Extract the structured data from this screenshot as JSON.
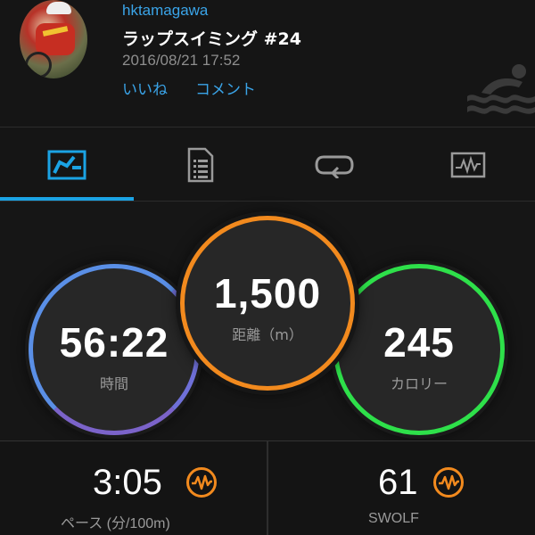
{
  "header": {
    "username": "hktamagawa",
    "activity_title": "ラップスイミング #24",
    "date": "2016/08/21 17:52",
    "like_label": "いいね",
    "comment_label": "コメント"
  },
  "tabs": [
    {
      "name": "overview",
      "icon": "activity-overview-icon",
      "active": true
    },
    {
      "name": "details",
      "icon": "document-list-icon",
      "active": false
    },
    {
      "name": "laps",
      "icon": "laps-icon",
      "active": false
    },
    {
      "name": "charts",
      "icon": "chart-icon",
      "active": false
    }
  ],
  "metrics": {
    "time": {
      "value": "56:22",
      "label": "時間",
      "color": "#5a8fe6"
    },
    "distance": {
      "value": "1,500",
      "label": "距離（m）",
      "color": "#f28a1e"
    },
    "calories": {
      "value": "245",
      "label": "カロリー",
      "color": "#2ee04a"
    }
  },
  "stats": {
    "pace": {
      "value": "3:05",
      "label": "ペース (分/100m)",
      "icon": "chart-orange-icon"
    },
    "swolf": {
      "value": "61",
      "label": "SWOLF",
      "icon": "chart-orange-icon"
    }
  },
  "colors": {
    "accent": "#1ba3e4",
    "link": "#3aa4e8",
    "orange": "#f28a1e"
  }
}
